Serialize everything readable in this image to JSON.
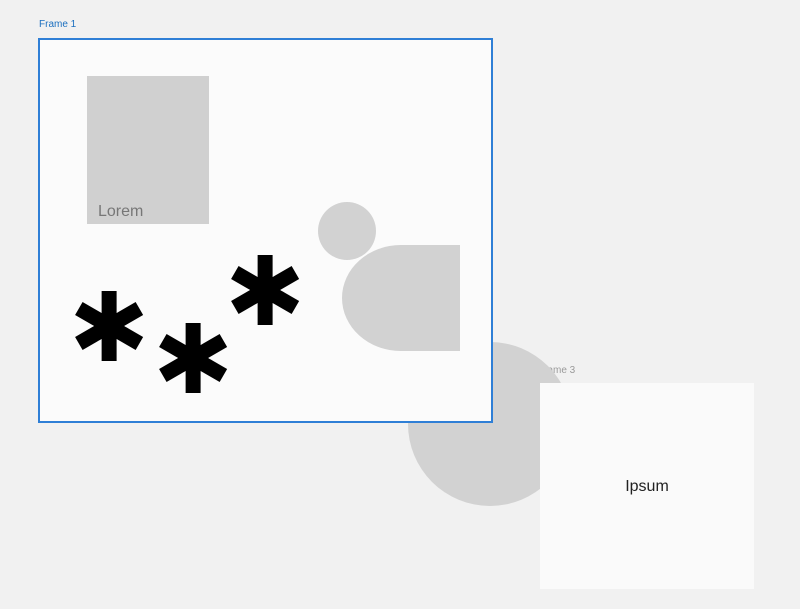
{
  "canvas": {
    "background": "#f1f1f1",
    "frames": [
      {
        "label": "Frame 1",
        "label_color": "#1b6fbf",
        "selected": true,
        "border_color": "#2f7fd6"
      },
      {
        "label": "Frame 3",
        "label_color": "#9a9a9a",
        "selected": false
      }
    ]
  },
  "frame1": {
    "rect_text": "Lorem",
    "asterisk_glyph": "✱",
    "shape_fill": "#d2d2d2"
  },
  "frame3": {
    "text": "Ipsum"
  }
}
